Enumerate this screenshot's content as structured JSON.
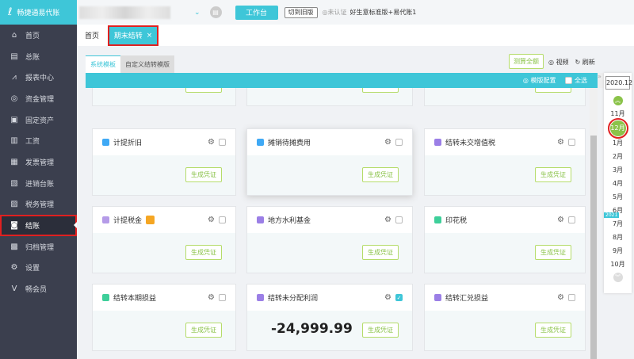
{
  "app": {
    "logo": "畅捷通易代账"
  },
  "sidebar": {
    "items": [
      {
        "label": "首页",
        "icon": "⌂"
      },
      {
        "label": "总账",
        "icon": "▤"
      },
      {
        "label": "报表中心",
        "icon": "⩘"
      },
      {
        "label": "资金管理",
        "icon": "◎"
      },
      {
        "label": "固定资产",
        "icon": "▣"
      },
      {
        "label": "工资",
        "icon": "▥"
      },
      {
        "label": "发票管理",
        "icon": "▦"
      },
      {
        "label": "进销台账",
        "icon": "▧"
      },
      {
        "label": "税务管理",
        "icon": "▨"
      },
      {
        "label": "结账",
        "icon": "◙",
        "active": true
      },
      {
        "label": "归档管理",
        "icon": "▩"
      },
      {
        "label": "设置",
        "icon": "⚙"
      },
      {
        "label": "畅会员",
        "icon": "V"
      }
    ]
  },
  "topbar": {
    "workbench": "工作台",
    "switch_old": "切到旧版",
    "cert": "◎未认证",
    "plan": "好生意标准版+易代账1"
  },
  "tabs": {
    "home": "首页",
    "active": "期末结转",
    "close": "×"
  },
  "subtabs": [
    "系统模板",
    "自定义结转模版"
  ],
  "actions": {
    "calc_all": "测算全额",
    "video": "◎ 视频",
    "refresh": "↻ 刷新"
  },
  "bar": {
    "config": "◎ 模版配置",
    "select_all": "全选"
  },
  "gen_label": "生成凭证",
  "cards": [
    {
      "title": "",
      "icon_color": "#3ec6d8"
    },
    {
      "title": "",
      "icon_color": "#3ec6d8"
    },
    {
      "title": "",
      "icon_color": "#3ec6d8"
    },
    {
      "title": "计提折旧",
      "icon_color": "#3fa9f5"
    },
    {
      "title": "摊销待摊费用",
      "icon_color": "#3fa9f5"
    },
    {
      "title": "结转未交增值税",
      "icon_color": "#9b7fe6"
    },
    {
      "title": "计提税金",
      "icon_color": "#b59be8",
      "tag": "▣"
    },
    {
      "title": "地方水利基金",
      "icon_color": "#9b7fe6"
    },
    {
      "title": "印花税",
      "icon_color": "#3ecf9a"
    },
    {
      "title": "结转本期损益",
      "icon_color": "#3ecf9a"
    },
    {
      "title": "结转未分配利润",
      "icon_color": "#9b7fe6",
      "checked": true,
      "amount": "-24,999.99"
    },
    {
      "title": "结转汇兑损益",
      "icon_color": "#9b7fe6"
    }
  ],
  "calendar": {
    "year": "2020.12",
    "badge": "2021",
    "months_before": [
      "11月"
    ],
    "current": "12月",
    "months_after": [
      "1月",
      "2月",
      "3月",
      "4月",
      "5月",
      "6月",
      "7月",
      "8月",
      "9月",
      "10月"
    ]
  }
}
